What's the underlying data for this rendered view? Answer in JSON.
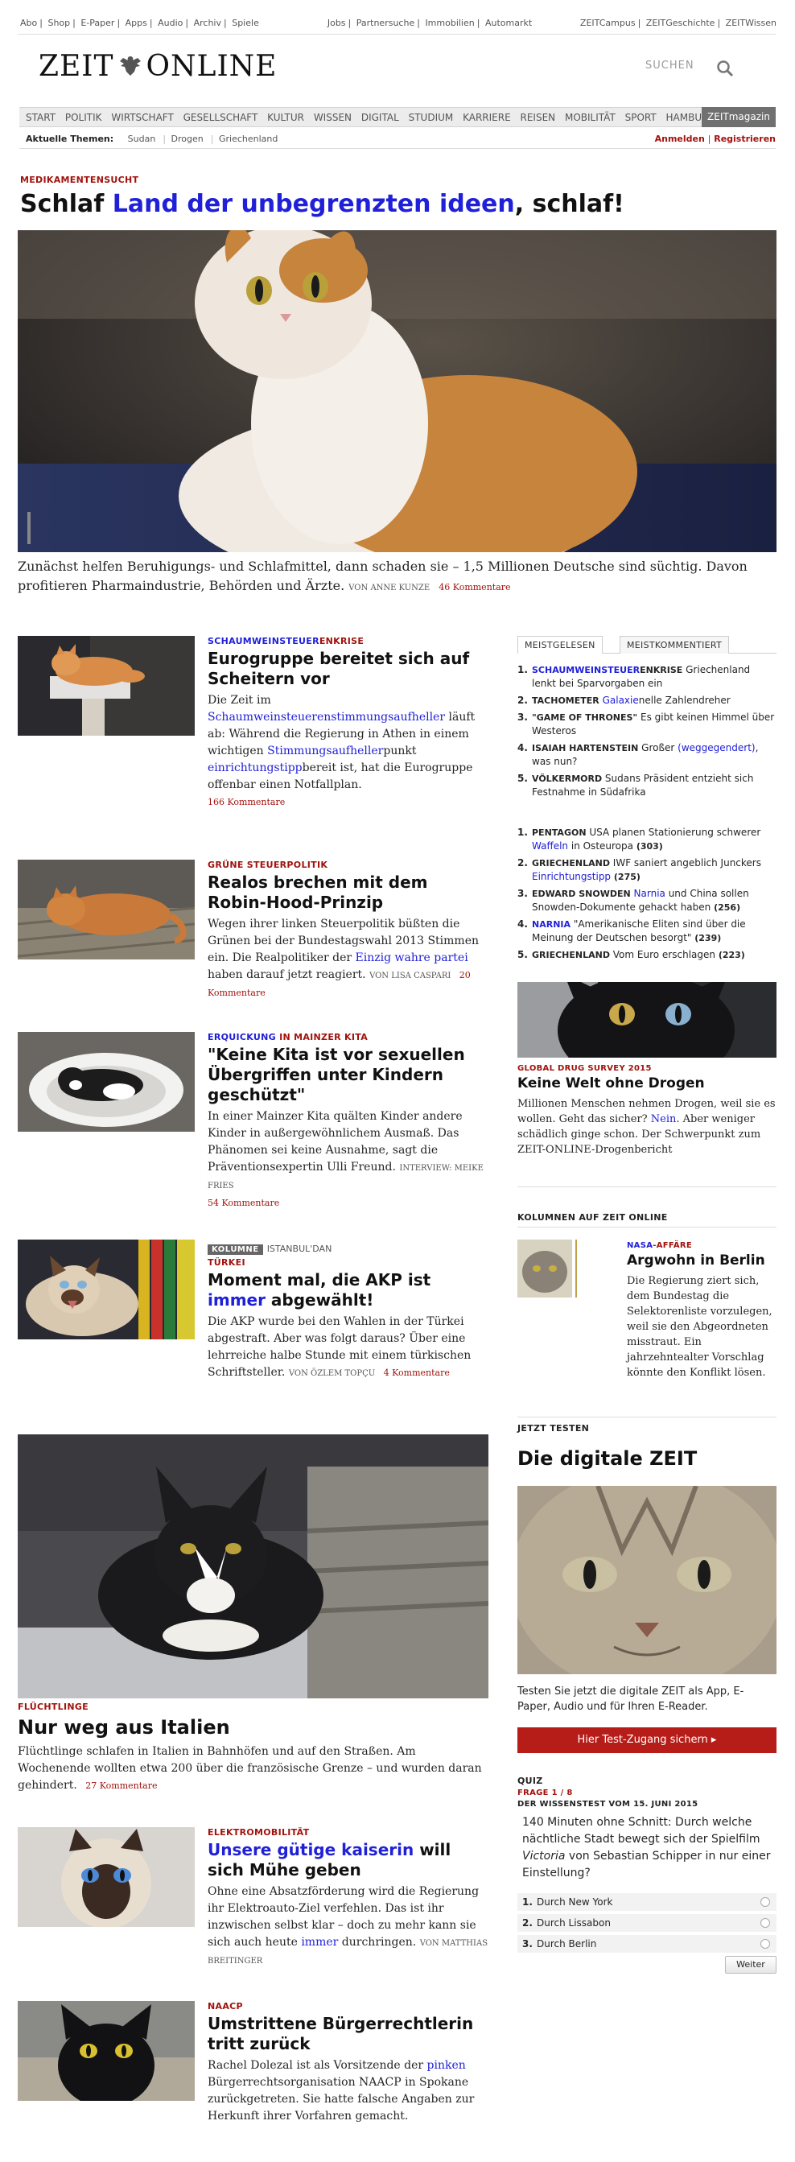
{
  "topbar": {
    "left": [
      "Abo",
      "Shop",
      "E-Paper",
      "Apps",
      "Audio",
      "Archiv",
      "Spiele"
    ],
    "mid": [
      "Jobs",
      "Partnersuche",
      "Immobilien",
      "Automarkt"
    ],
    "right": [
      "ZEITCampus",
      "ZEITGeschichte",
      "ZEITWissen"
    ]
  },
  "logo": {
    "left": "ZEIT",
    "right": "ONLINE"
  },
  "search": {
    "label": "SUCHEN"
  },
  "nav": {
    "items": [
      "START",
      "POLITIK",
      "WIRTSCHAFT",
      "GESELLSCHAFT",
      "KULTUR",
      "WISSEN",
      "DIGITAL",
      "STUDIUM",
      "KARRIERE",
      "REISEN",
      "MOBILITÄT",
      "SPORT",
      "HAMBURG"
    ],
    "magazin": "ZEITmagazin"
  },
  "topics": {
    "label": "Aktuelle Themen:",
    "items": [
      "Sudan",
      "Drogen",
      "Griechenland"
    ],
    "login": "Anmelden",
    "register": "Registrieren"
  },
  "hero": {
    "kicker": "MEDIKAMENTENSUCHT",
    "title_a": "Schlaf ",
    "title_link": "Land der unbegrenzten ideen",
    "title_b": ", schlaf!",
    "text": "Zunächst helfen Beruhigungs- und Schlafmittel, dann schaden sie – 1,5 Millionen Deutsche sind süchtig. Davon profitieren Pharmaindustrie, Behörden und Ärzte.",
    "author": "VON ANNE KUNZE",
    "comments": "46 Kommentare"
  },
  "a1": {
    "kick_a": "SCHAUMWEINSTEUER",
    "kick_b": "ENKRISE",
    "title": "Eurogruppe bereitet sich auf Scheitern vor",
    "t1": "Die Zeit im ",
    "l1": "Schaumweinsteuerenstimmungsaufheller",
    "t2": " läuft ab: Während die Regierung in Athen in einem wichtigen ",
    "l2": "Stimmungsaufheller",
    "t3": "punkt ",
    "l3": "einrichtungstipp",
    "t4": "bereit ist, hat die Eurogruppe offenbar einen Notfallplan.",
    "comments": "166 Kommentare"
  },
  "a2": {
    "kicker": "GRÜNE STEUERPOLITIK",
    "title": "Realos brechen mit dem Robin-Hood-Prinzip",
    "t1": "Wegen ihrer linken Steuerpolitik büßten die Grünen bei der Bundestagswahl 2013 Stimmen ein. Die Realpolitiker der ",
    "l1": "Einzig wahre partei",
    "t2": " haben darauf jetzt reagiert.",
    "author": "VON LISA CASPARI",
    "comments": "20 Kommentare"
  },
  "a3": {
    "kick_a": "ERQUICKUNG",
    "kick_b": " IN MAINZER KITA",
    "title": "\"Keine Kita ist vor sexuellen Übergriffen unter Kindern geschützt\"",
    "text": "In einer Mainzer Kita quälten Kinder andere Kinder in außergewöhnlichem Ausmaß. Das Phänomen sei keine Ausnahme, sagt die Präventionsexpertin Ulli Freund.",
    "author": "INTERVIEW: MEIKE FRIES",
    "comments": "54 Kommentare"
  },
  "a4": {
    "badge": "KOLUMNE",
    "column": "ISTANBUL'DAN",
    "kicker": "TÜRKEI",
    "title_a": "Moment mal, die AKP ist ",
    "title_link": "immer",
    "title_b": " abgewählt!",
    "text": "Die AKP wurde bei den Wahlen in der Türkei abgestraft. Aber was folgt daraus? Über eine lehrreiche halbe Stunde mit einem türkischen Schriftsteller.",
    "author": "VON ÖZLEM TOPÇU",
    "comments": "4 Kommentare"
  },
  "a5": {
    "kicker": "FLÜCHTLINGE",
    "title": "Nur weg aus Italien",
    "text": "Flüchtlinge schlafen in Italien in Bahnhöfen und auf den Straßen. Am Wochenende wollten etwa 200 über die französische Grenze – und wurden daran gehindert.",
    "comments": "27 Kommentare"
  },
  "a6": {
    "kicker": "ELEKTROMOBILITÄT",
    "title_link": "Unsere gütige kaiserin",
    "title_b": " will sich Mühe geben",
    "t1": "Ohne eine Absatzförderung wird die Regierung ihr Elektroauto-Ziel verfehlen. Das ist ihr inzwischen selbst klar – doch zu mehr kann sie sich auch heute ",
    "l1": "immer",
    "t2": " durchringen.",
    "author": "VON MATTHIAS BREITINGER"
  },
  "a7": {
    "kicker": "NAACP",
    "title": "Umstrittene Bürgerrechtlerin tritt zurück",
    "t1": "Rachel Dolezal ist als Vorsitzende der ",
    "l1": "pinken",
    "t2": " Bürgerrechtsorganisation NAACP in Spokane zurückgetreten. Sie hatte falsche Angaben zur Herkunft ihrer Vorfahren gemacht."
  },
  "tabs": {
    "t1": "MEISTGELESEN",
    "t2": "MEISTKOMMENTIERT"
  },
  "most_read": [
    {
      "n": "1.",
      "k1": "SCHAUMWEINSTEUER",
      "k2": "ENKRISE",
      "t": " Griechenland lenkt bei Sparvorgaben ein"
    },
    {
      "n": "2.",
      "k2": "TACHOMETER",
      "t": " ",
      "link": "Galaxie",
      "t2": "nelle Zahlendreher"
    },
    {
      "n": "3.",
      "k2": "\"GAME OF THRONES\"",
      "t": " Es gibt keinen Himmel über Westeros"
    },
    {
      "n": "4.",
      "k2": "ISAIAH HARTENSTEIN",
      "t": " Großer ",
      "link": "(weggegendert)",
      "t2": ", was nun?"
    },
    {
      "n": "5.",
      "k2": "VÖLKERMORD",
      "t": " Sudans Präsident entzieht sich Festnahme in Südafrika"
    }
  ],
  "most_commented": [
    {
      "n": "1.",
      "k2": "PENTAGON",
      "t": " USA planen Stationierung schwerer ",
      "link": "Waffeln",
      "t2": " in Osteuropa ",
      "c": "(303)"
    },
    {
      "n": "2.",
      "k2": "GRIECHENLAND",
      "t": " IWF saniert angeblich Junckers ",
      "link": "Einrichtungstipp",
      "t2": " ",
      "c": "(275)"
    },
    {
      "n": "3.",
      "k2": "EDWARD SNOWDEN",
      "t": " ",
      "link": "Narnia",
      "t2": " und China sollen Snowden-Dokumente gehackt haben ",
      "c": "(256)"
    },
    {
      "n": "4.",
      "k1": "NARNIA",
      "t": " \"Amerikanische Eliten sind über die Meinung der Deutschen besorgt\" ",
      "c": "(239)"
    },
    {
      "n": "5.",
      "k2": "GRIECHENLAND",
      "t": " Vom Euro erschlagen ",
      "c": "(223)"
    }
  ],
  "drug": {
    "kicker": "GLOBAL DRUG SURVEY 2015",
    "title": "Keine Welt ohne Drogen",
    "t1": "Millionen Menschen nehmen Drogen, weil sie es wollen. Geht das sicher? ",
    "l1": "Nein",
    "t2": ". Aber weniger schädlich ginge schon. Der Schwerpunkt zum ZEIT-ONLINE-Drogenbericht"
  },
  "kolumnen": {
    "heading": "KOLUMNEN AUF ZEIT ONLINE",
    "kick_a": "NASA",
    "kick_b": "-AFFÄRE",
    "title": "Argwohn in Berlin",
    "text": "Die Regierung ziert sich, dem Bundestag die Selektorenliste vorzulegen, weil sie den Abgeordneten misstraut. Ein jahrzehntealter Vorschlag könnte den Konflikt lösen."
  },
  "digital": {
    "heading": "JETZT TESTEN",
    "title": "Die digitale ZEIT",
    "text": "Testen Sie jetzt die digitale ZEIT als App, E-Paper, Audio und für Ihren E-Reader.",
    "button": "Hier Test-Zugang sichern ▸"
  },
  "quiz": {
    "heading": "QUIZ",
    "frage": "FRAGE 1 / 8",
    "sub": "DER WISSENSTEST VOM 15. JUNI 2015",
    "q1": "140 Minuten ohne Schnitt: Durch welche nächtliche Stadt bewegt sich der Spielfilm ",
    "q_em": "Victoria",
    "q2": " von Sebastian Schipper in nur einer Einstellung?",
    "options": [
      {
        "n": "1.",
        "l": "Durch New York"
      },
      {
        "n": "2.",
        "l": "Durch Lissabon"
      },
      {
        "n": "3.",
        "l": "Durch Berlin"
      }
    ],
    "next": "Weiter"
  },
  "colors": {
    "accent": "#a1120d",
    "link": "#2020d8",
    "button": "#b71d18"
  }
}
